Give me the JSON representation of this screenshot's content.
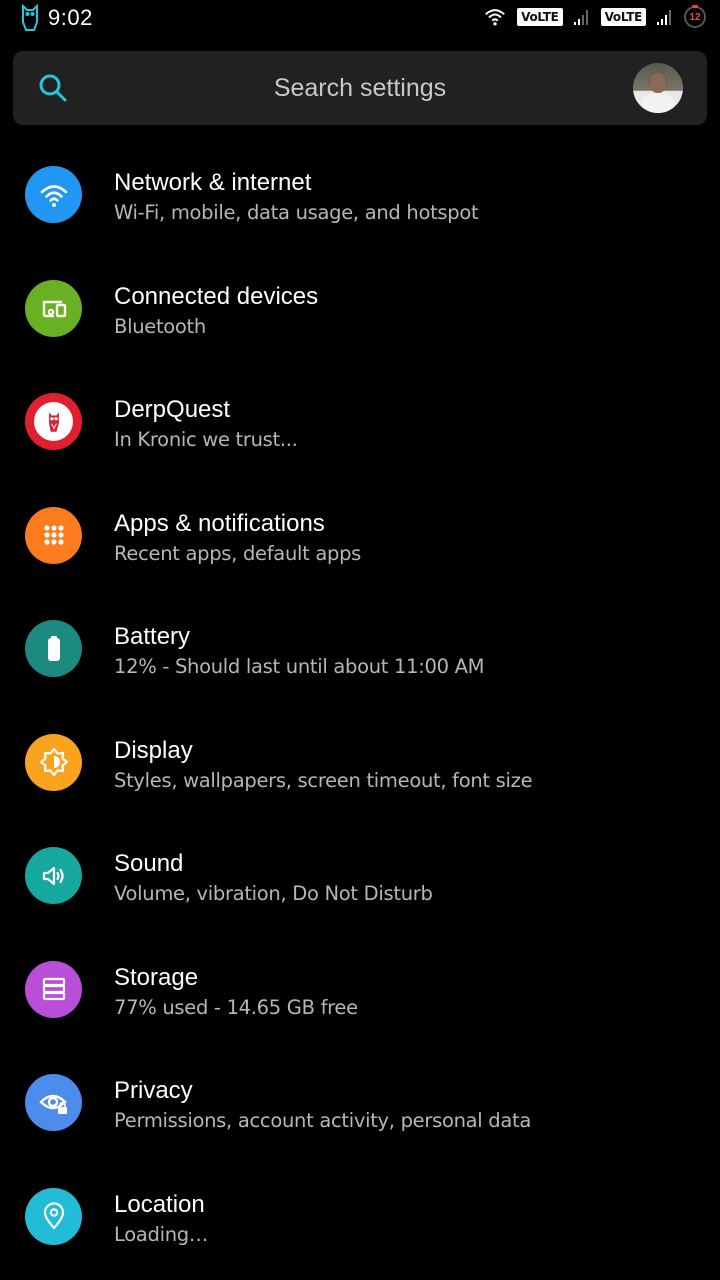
{
  "status_bar": {
    "time": "9:02",
    "sim1_badge": "VoLTE",
    "sim2_badge": "VoLTE",
    "battery_level": "12",
    "icons": [
      "owl-notification-icon",
      "wifi-icon",
      "signal-icon",
      "signal-icon",
      "battery-icon"
    ]
  },
  "search": {
    "placeholder": "Search settings",
    "icon": "search-icon",
    "accent": "#26c6da"
  },
  "settings": [
    {
      "id": "network",
      "title": "Network & internet",
      "subtitle": "Wi-Fi, mobile, data usage, and hotspot",
      "icon": "wifi-icon",
      "color": "#2196f3"
    },
    {
      "id": "connected-devices",
      "title": "Connected devices",
      "subtitle": "Bluetooth",
      "icon": "devices-icon",
      "color": "#6ab023"
    },
    {
      "id": "derpquest",
      "title": "DerpQuest",
      "subtitle": "In Kronic we trust...",
      "icon": "owl-icon",
      "color": "#e0202e"
    },
    {
      "id": "apps",
      "title": "Apps & notifications",
      "subtitle": "Recent apps, default apps",
      "icon": "apps-grid-icon",
      "color": "#fb7b1e"
    },
    {
      "id": "battery",
      "title": "Battery",
      "subtitle": "12% - Should last until about 11:00 AM",
      "icon": "battery-icon",
      "color": "#1d8a80"
    },
    {
      "id": "display",
      "title": "Display",
      "subtitle": "Styles, wallpapers, screen timeout, font size",
      "icon": "brightness-icon",
      "color": "#f9a31f"
    },
    {
      "id": "sound",
      "title": "Sound",
      "subtitle": "Volume, vibration, Do Not Disturb",
      "icon": "volume-icon",
      "color": "#16a79e"
    },
    {
      "id": "storage",
      "title": "Storage",
      "subtitle": "77% used - 14.65 GB free",
      "icon": "storage-icon",
      "color": "#b94ed8"
    },
    {
      "id": "privacy",
      "title": "Privacy",
      "subtitle": "Permissions, account activity, personal data",
      "icon": "privacy-eye-lock-icon",
      "color": "#4e8cec"
    },
    {
      "id": "location",
      "title": "Location",
      "subtitle": "Loading…",
      "icon": "location-pin-icon",
      "color": "#22bcd6"
    }
  ]
}
